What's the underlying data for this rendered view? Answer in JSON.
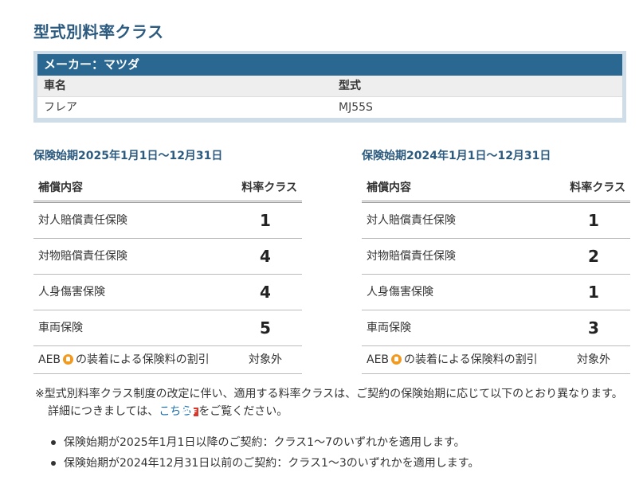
{
  "page_title": "型式別料率クラス",
  "maker": {
    "header": "メーカー：マツダ",
    "col_name_label": "車名",
    "col_model_label": "型式",
    "car_name": "フレア",
    "model_code": "MJ55S"
  },
  "periods": [
    {
      "title": "保険始期2025年1月1日～12月31日",
      "col_coverage": "補償内容",
      "col_class": "料率クラス",
      "rows": [
        {
          "label": "対人賠償責任保険",
          "value": "1"
        },
        {
          "label": "対物賠償責任保険",
          "value": "4"
        },
        {
          "label": "人身傷害保険",
          "value": "4"
        },
        {
          "label": "車両保険",
          "value": "5"
        }
      ],
      "aeb": {
        "prefix": "AEB",
        "suffix": "の装着による保険料の割引",
        "value": "対象外"
      }
    },
    {
      "title": "保険始期2024年1月1日～12月31日",
      "col_coverage": "補償内容",
      "col_class": "料率クラス",
      "rows": [
        {
          "label": "対人賠償責任保険",
          "value": "1"
        },
        {
          "label": "対物賠償責任保険",
          "value": "2"
        },
        {
          "label": "人身傷害保険",
          "value": "1"
        },
        {
          "label": "車両保険",
          "value": "3"
        }
      ],
      "aeb": {
        "prefix": "AEB",
        "suffix": "の装着による保険料の割引",
        "value": "対象外"
      }
    }
  ],
  "note": {
    "text_before_link": "※型式別料率クラス制度の改定に伴い、適用する料率クラスは、ご契約の保険始期に応じて以下のとおり異なります。詳細につきましては、",
    "link_text": "こちら",
    "pdf_badge": "PDF",
    "text_after_link": "をご覧ください。"
  },
  "bullets": [
    "保険始期が2025年1月1日以降のご契約：クラス1～7のいずれかを適用します。",
    "保険始期が2024年12月31日以前のご契約：クラス1～3のいずれかを適用します。"
  ],
  "icons": {
    "aeb": "aeb-car-icon",
    "pdf": "pdf-icon"
  }
}
